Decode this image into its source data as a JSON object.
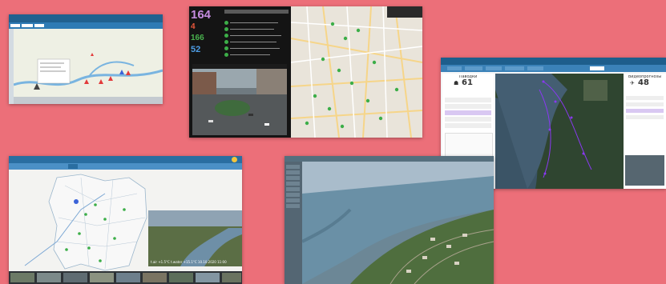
{
  "screen_dashboard": {
    "stats": [
      {
        "value": "164",
        "color": "#c58ce0"
      },
      {
        "value": "4",
        "color": "#e8573b"
      },
      {
        "value": "166",
        "color": "#49b24e"
      },
      {
        "value": "52",
        "color": "#4d9de6"
      }
    ]
  },
  "screen_river_monitor": {
    "panel_left_title": "Паводки",
    "panel_left_value": "61",
    "panel_right_title": "Видеопрогнозы",
    "panel_right_value": "48"
  },
  "screen_region_map": {
    "video_overlay_text": "t.air +1.5°C  t.water +15.1°C  10.10.2020 11:00"
  },
  "colors": {
    "background": "#ec6f79",
    "header_blue": "#2a6ea1",
    "marker_red": "#e23b3b",
    "marker_green": "#3cae48",
    "marker_blue": "#3b63d8",
    "route_purple": "#8a38f2"
  }
}
